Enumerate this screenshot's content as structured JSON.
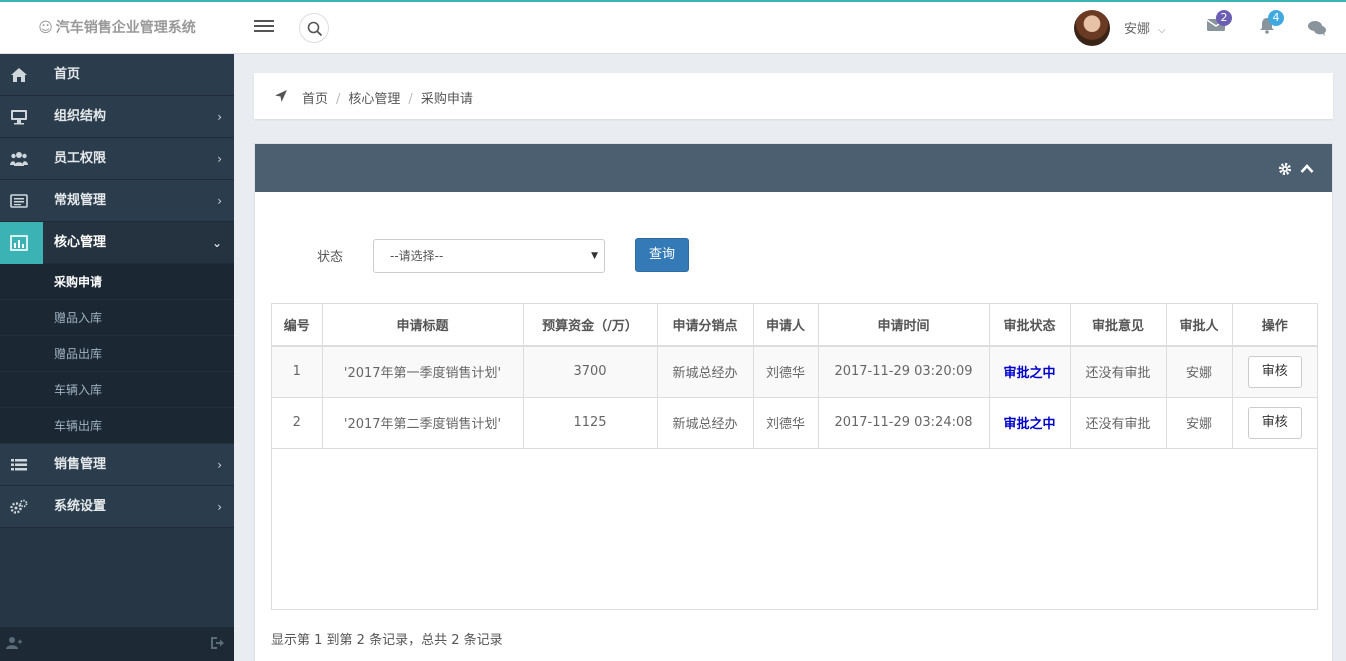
{
  "brand": {
    "title": "汽车销售企业管理系统",
    "smile": "☺"
  },
  "topbar": {
    "username": "安娜",
    "mail_count": "2",
    "bell_count": "4",
    "mail_badge_color": "#6b5fb5",
    "bell_badge_color": "#3fa9e0"
  },
  "sidebar": {
    "items": [
      {
        "label": "首页",
        "icon": "home-icon"
      },
      {
        "label": "组织结构",
        "icon": "desktop-icon",
        "arrow": "›"
      },
      {
        "label": "员工权限",
        "icon": "users-icon",
        "arrow": "›"
      },
      {
        "label": "常规管理",
        "icon": "list-box-icon",
        "arrow": "›"
      },
      {
        "label": "核心管理",
        "icon": "bar-chart-icon",
        "arrow": "⌄"
      },
      {
        "label": "销售管理",
        "icon": "list-icon",
        "arrow": "›"
      },
      {
        "label": "系统设置",
        "icon": "cogs-icon",
        "arrow": "›"
      }
    ],
    "sub_items": [
      "采购申请",
      "赠品入库",
      "赠品出库",
      "车辆入库",
      "车辆出库"
    ]
  },
  "breadcrumb": {
    "home": "首页",
    "section": "核心管理",
    "current": "采购申请",
    "sep": "/"
  },
  "filter": {
    "label": "状态",
    "select_value": "--请选择--",
    "query_label": "查询"
  },
  "table": {
    "headers": [
      "编号",
      "申请标题",
      "预算资金（/万）",
      "申请分销点",
      "申请人",
      "申请时间",
      "审批状态",
      "审批意见",
      "审批人",
      "操作"
    ],
    "rows": [
      {
        "id": "1",
        "title": "'2017年第一季度销售计划'",
        "budget": "3700",
        "branch": "新城总经办",
        "applicant": "刘德华",
        "time": "2017-11-29 03:20:09",
        "status": "审批之中",
        "opinion": "还没有审批",
        "approver": "安娜",
        "action": "审核"
      },
      {
        "id": "2",
        "title": "'2017年第二季度销售计划'",
        "budget": "1125",
        "branch": "新城总经办",
        "applicant": "刘德华",
        "time": "2017-11-29 03:24:08",
        "status": "审批之中",
        "opinion": "还没有审批",
        "approver": "安娜",
        "action": "审核"
      }
    ]
  },
  "pager": {
    "text": "显示第 1 到第 2 条记录，总共 2 条记录"
  }
}
